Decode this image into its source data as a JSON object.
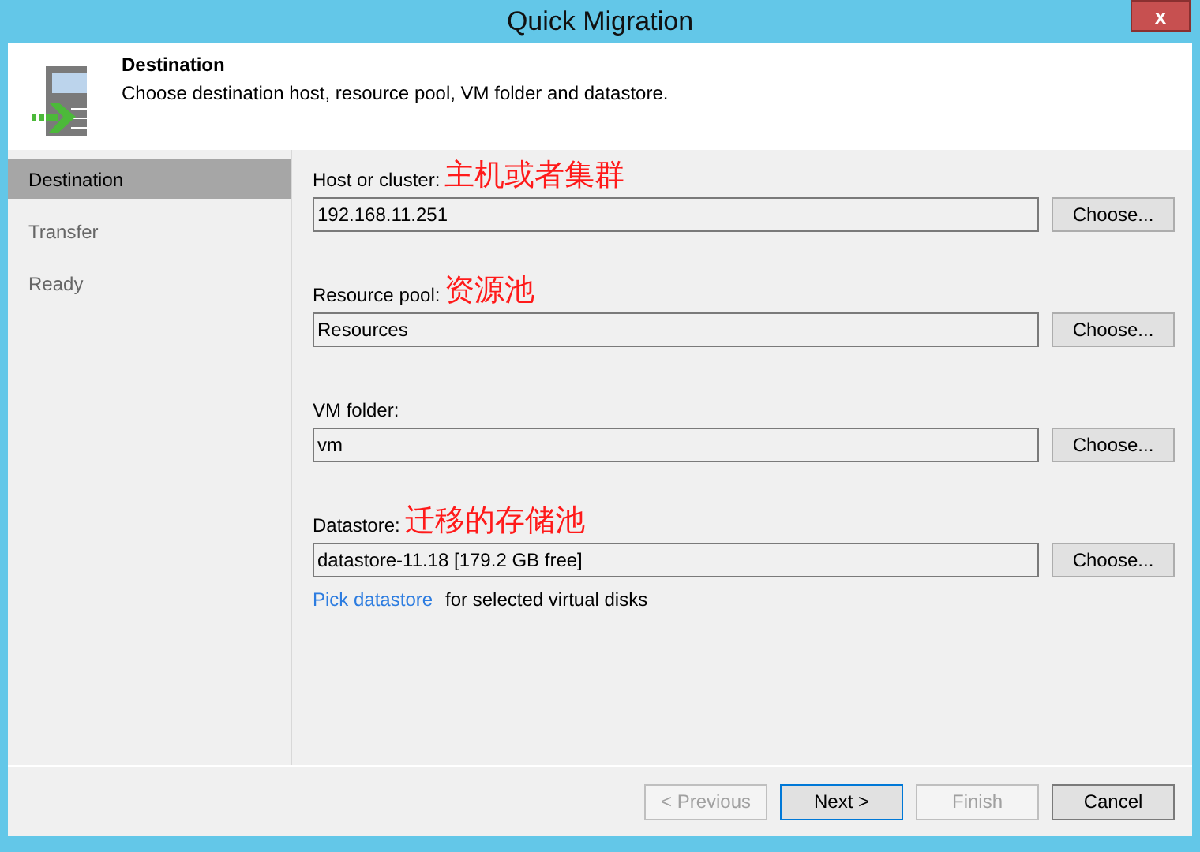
{
  "window": {
    "title": "Quick Migration",
    "close": "x"
  },
  "header": {
    "title": "Destination",
    "description": "Choose destination host, resource pool, VM folder and datastore."
  },
  "steps": [
    {
      "label": "Destination",
      "selected": true
    },
    {
      "label": "Transfer",
      "selected": false
    },
    {
      "label": "Ready",
      "selected": false
    }
  ],
  "fields": [
    {
      "label": "Host or cluster:",
      "annotation": "主机或者集群",
      "value": "192.168.11.251",
      "button": "Choose..."
    },
    {
      "label": "Resource pool:",
      "annotation": "资源池",
      "value": "Resources",
      "button": "Choose..."
    },
    {
      "label": "VM folder:",
      "value": "vm",
      "button": "Choose..."
    },
    {
      "label": "Datastore:",
      "annotation": "迁移的存储池",
      "value": "datastore-11.18 [179.2 GB free]",
      "button": "Choose..."
    }
  ],
  "datastore_hint": {
    "link": "Pick datastore",
    "text": "for selected virtual disks"
  },
  "buttons": [
    {
      "label": "< Previous",
      "disabled": true,
      "default": false
    },
    {
      "label": "Next >",
      "disabled": false,
      "default": true
    },
    {
      "label": "Finish",
      "disabled": true,
      "default": false
    },
    {
      "label": "Cancel",
      "disabled": false,
      "default": false
    }
  ]
}
